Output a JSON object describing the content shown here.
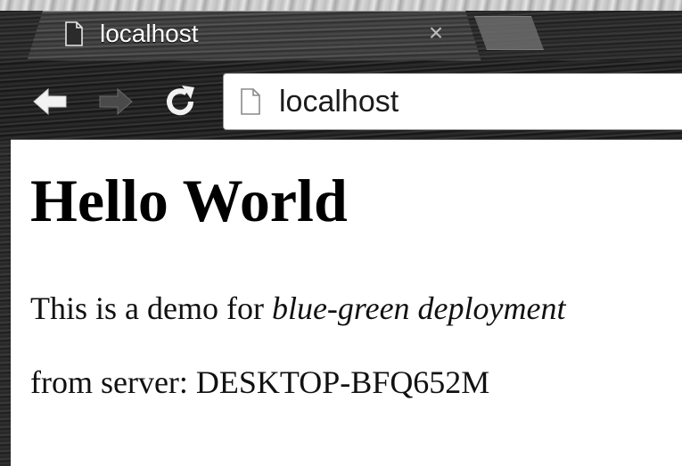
{
  "browser": {
    "tab": {
      "title": "localhost",
      "favicon": "page-icon",
      "close_symbol": "×"
    },
    "toolbar": {
      "back_icon": "back-arrow-icon",
      "forward_icon": "forward-arrow-icon",
      "reload_icon": "reload-icon",
      "address": "localhost",
      "address_icon": "page-icon"
    }
  },
  "page": {
    "heading": "Hello World",
    "demo_prefix": "This is a demo for",
    "demo_emphasis": "blue-green deployment",
    "server_line": "from server: DESKTOP-BFQ652M"
  },
  "colors": {
    "page_background": "#ffffff",
    "text": "#000000",
    "frame": "#2a2a2a"
  }
}
